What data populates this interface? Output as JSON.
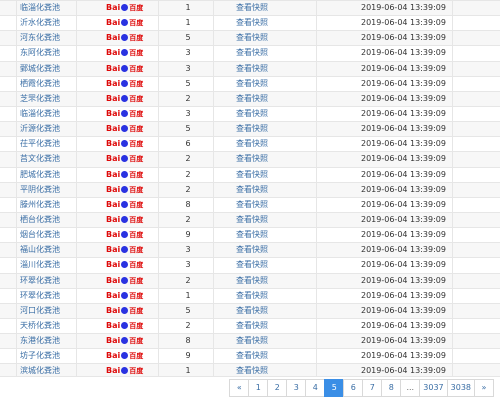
{
  "engine_label_latin": "Bai",
  "engine_label_cn": "百度",
  "rows": [
    {
      "keyword": "临淄化粪池",
      "rank": "1",
      "snapshot": "查看快照",
      "time": "2019-06-04 13:39:09"
    },
    {
      "keyword": "沂水化粪池",
      "rank": "1",
      "snapshot": "查看快照",
      "time": "2019-06-04 13:39:09"
    },
    {
      "keyword": "河东化粪池",
      "rank": "5",
      "snapshot": "查看快照",
      "time": "2019-06-04 13:39:09"
    },
    {
      "keyword": "东阿化粪池",
      "rank": "3",
      "snapshot": "查看快照",
      "time": "2019-06-04 13:39:09"
    },
    {
      "keyword": "鄄城化粪池",
      "rank": "3",
      "snapshot": "查看快照",
      "time": "2019-06-04 13:39:09"
    },
    {
      "keyword": "栖霞化粪池",
      "rank": "5",
      "snapshot": "查看快照",
      "time": "2019-06-04 13:39:09"
    },
    {
      "keyword": "芝罘化粪池",
      "rank": "2",
      "snapshot": "查看快照",
      "time": "2019-06-04 13:39:09"
    },
    {
      "keyword": "临淄化粪池",
      "rank": "3",
      "snapshot": "查看快照",
      "time": "2019-06-04 13:39:09"
    },
    {
      "keyword": "沂源化粪池",
      "rank": "5",
      "snapshot": "查看快照",
      "time": "2019-06-04 13:39:09"
    },
    {
      "keyword": "茌平化粪池",
      "rank": "6",
      "snapshot": "查看快照",
      "time": "2019-06-04 13:39:09"
    },
    {
      "keyword": "莒文化粪池",
      "rank": "2",
      "snapshot": "查看快照",
      "time": "2019-06-04 13:39:09"
    },
    {
      "keyword": "肥城化粪池",
      "rank": "2",
      "snapshot": "查看快照",
      "time": "2019-06-04 13:39:09"
    },
    {
      "keyword": "平阴化粪池",
      "rank": "2",
      "snapshot": "查看快照",
      "time": "2019-06-04 13:39:09"
    },
    {
      "keyword": "滕州化粪池",
      "rank": "8",
      "snapshot": "查看快照",
      "time": "2019-06-04 13:39:09"
    },
    {
      "keyword": "栖台化粪池",
      "rank": "2",
      "snapshot": "查看快照",
      "time": "2019-06-04 13:39:09"
    },
    {
      "keyword": "烟台化粪池",
      "rank": "9",
      "snapshot": "查看快照",
      "time": "2019-06-04 13:39:09"
    },
    {
      "keyword": "福山化粪池",
      "rank": "3",
      "snapshot": "查看快照",
      "time": "2019-06-04 13:39:09"
    },
    {
      "keyword": "淄川化粪池",
      "rank": "3",
      "snapshot": "查看快照",
      "time": "2019-06-04 13:39:09"
    },
    {
      "keyword": "环翠化粪池",
      "rank": "2",
      "snapshot": "查看快照",
      "time": "2019-06-04 13:39:09"
    },
    {
      "keyword": "环翠化粪池",
      "rank": "1",
      "snapshot": "查看快照",
      "time": "2019-06-04 13:39:09"
    },
    {
      "keyword": "河口化粪池",
      "rank": "5",
      "snapshot": "查看快照",
      "time": "2019-06-04 13:39:09"
    },
    {
      "keyword": "天桥化粪池",
      "rank": "2",
      "snapshot": "查看快照",
      "time": "2019-06-04 13:39:09"
    },
    {
      "keyword": "东港化粪池",
      "rank": "8",
      "snapshot": "查看快照",
      "time": "2019-06-04 13:39:09"
    },
    {
      "keyword": "坊子化粪池",
      "rank": "9",
      "snapshot": "查看快照",
      "time": "2019-06-04 13:39:09"
    },
    {
      "keyword": "滨城化粪池",
      "rank": "1",
      "snapshot": "查看快照",
      "time": "2019-06-04 13:39:09"
    }
  ],
  "pagination": {
    "prev": "«",
    "pages": [
      "1",
      "2",
      "3",
      "4",
      "5",
      "6",
      "7",
      "8",
      "...",
      "3037",
      "3038"
    ],
    "active": "5",
    "next": "»"
  }
}
